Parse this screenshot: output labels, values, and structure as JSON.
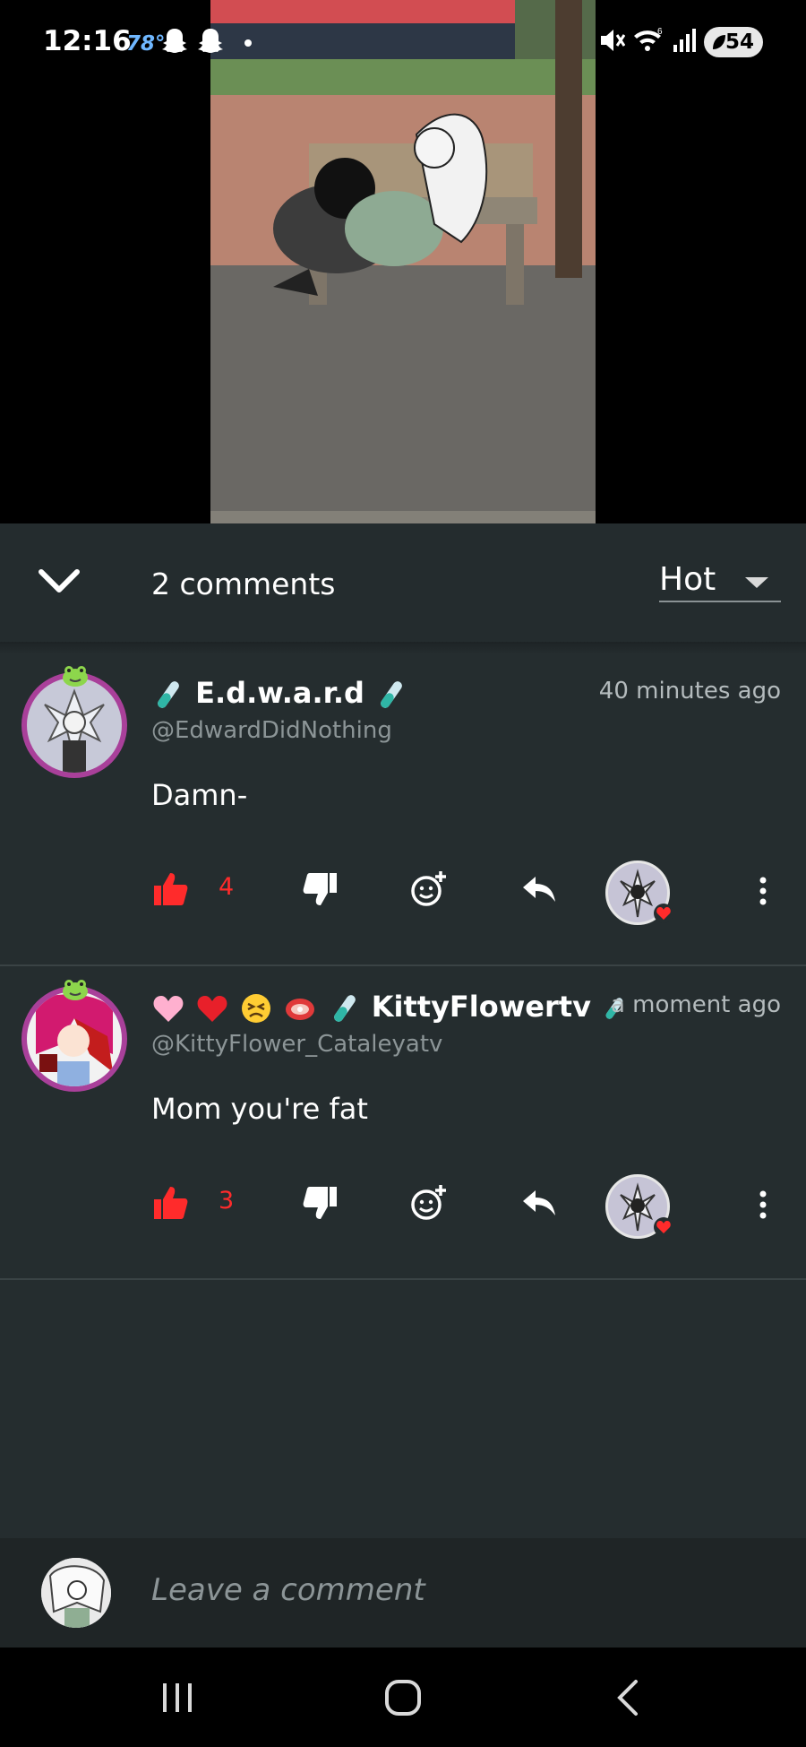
{
  "status_bar": {
    "time": "12:16",
    "temperature": "78°",
    "battery": "54"
  },
  "comments_header": {
    "count_label": "2 comments",
    "sort_label": "Hot"
  },
  "comments": [
    {
      "author": "E.d.w.a.r.d",
      "handle": "@EdwardDidNothing",
      "time": "40 minutes ago",
      "text": "Damn-",
      "likes": "4"
    },
    {
      "author": "KittyFlowertv",
      "handle": "@KittyFlower_Cataleyatv",
      "time": "a moment ago",
      "text": "Mom you're fat",
      "likes": "3"
    }
  ],
  "comment_input": {
    "placeholder": "Leave a comment"
  },
  "colors": {
    "panel": "#252d2f",
    "like_red": "#ff2b2b",
    "avatar_ring": "#a9409a"
  }
}
